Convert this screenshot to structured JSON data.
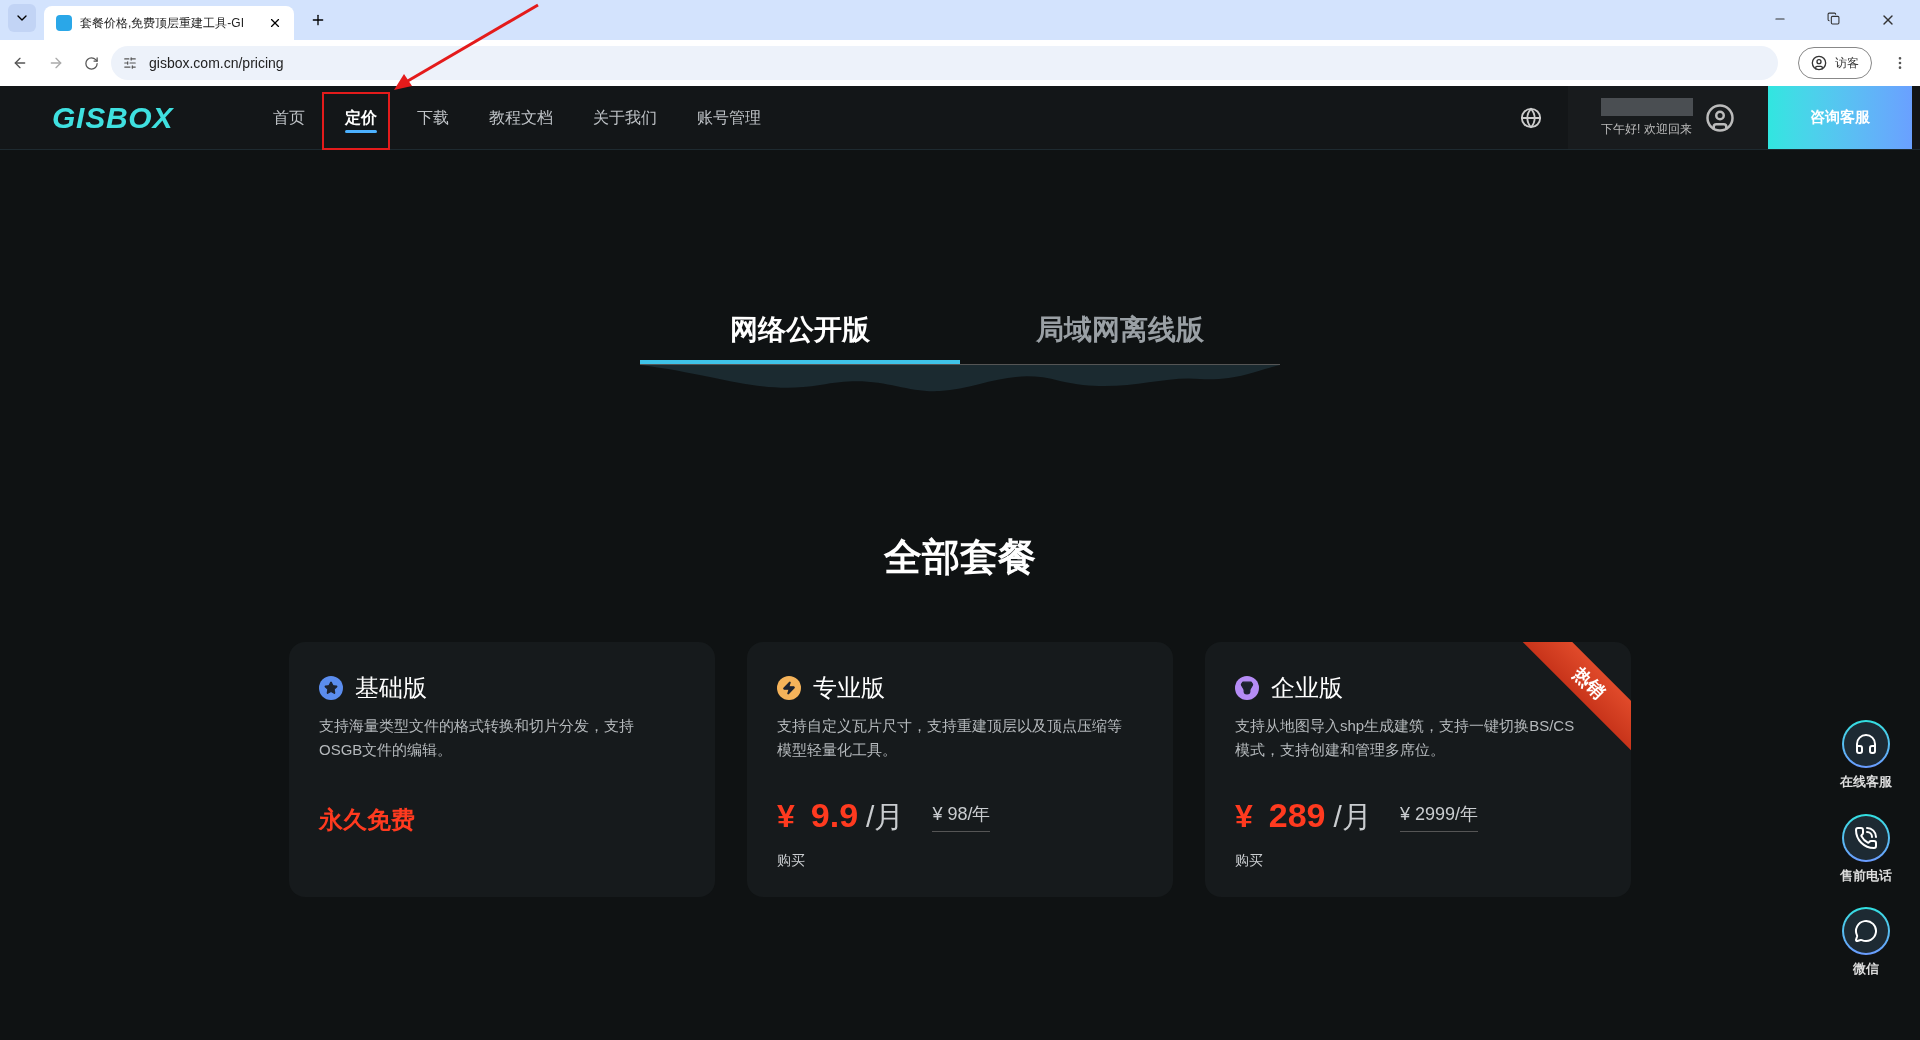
{
  "browser": {
    "tab_title": "套餐价格,免费顶层重建工具-GI",
    "url": "gisbox.com.cn/pricing",
    "profile": "访客"
  },
  "nav": {
    "logo": "GISBOX",
    "items": [
      {
        "label": "首页",
        "selected": false
      },
      {
        "label": "定价",
        "selected": true
      },
      {
        "label": "下载",
        "selected": false
      },
      {
        "label": "教程文档",
        "selected": false
      },
      {
        "label": "关于我们",
        "selected": false
      },
      {
        "label": "账号管理",
        "selected": false
      }
    ],
    "greeting": "下午好! 欢迎回来",
    "cta": "咨询客服"
  },
  "edition_tabs": [
    {
      "label": "网络公开版",
      "selected": true
    },
    {
      "label": "局域网离线版",
      "selected": false
    }
  ],
  "section_title": "全部套餐",
  "plans": [
    {
      "color": "#5b8def",
      "name": "基础版",
      "description": "支持海量类型文件的格式转换和切片分发，支持OSGB文件的编辑。",
      "kind": "free",
      "price_text": "永久免费"
    },
    {
      "color": "#f5b35a",
      "name": "专业版",
      "description": "支持自定义瓦片尺寸，支持重建顶层以及顶点压缩等模型轻量化工具。",
      "kind": "paid",
      "currency": "¥",
      "price": "9.9",
      "unit": "/月",
      "yearly": "¥ 98/年",
      "buy": "购买"
    },
    {
      "color": "#b58cf5",
      "name": "企业版",
      "description": "支持从地图导入shp生成建筑，支持一键切换BS/CS模式，支持创建和管理多席位。",
      "kind": "paid",
      "currency": "¥",
      "price": "289",
      "unit": "/月",
      "yearly": "¥ 2999/年",
      "buy": "购买",
      "badge": "热销"
    }
  ],
  "side_buttons": [
    {
      "label": "在线客服"
    },
    {
      "label": "售前电话"
    },
    {
      "label": "微信"
    }
  ]
}
